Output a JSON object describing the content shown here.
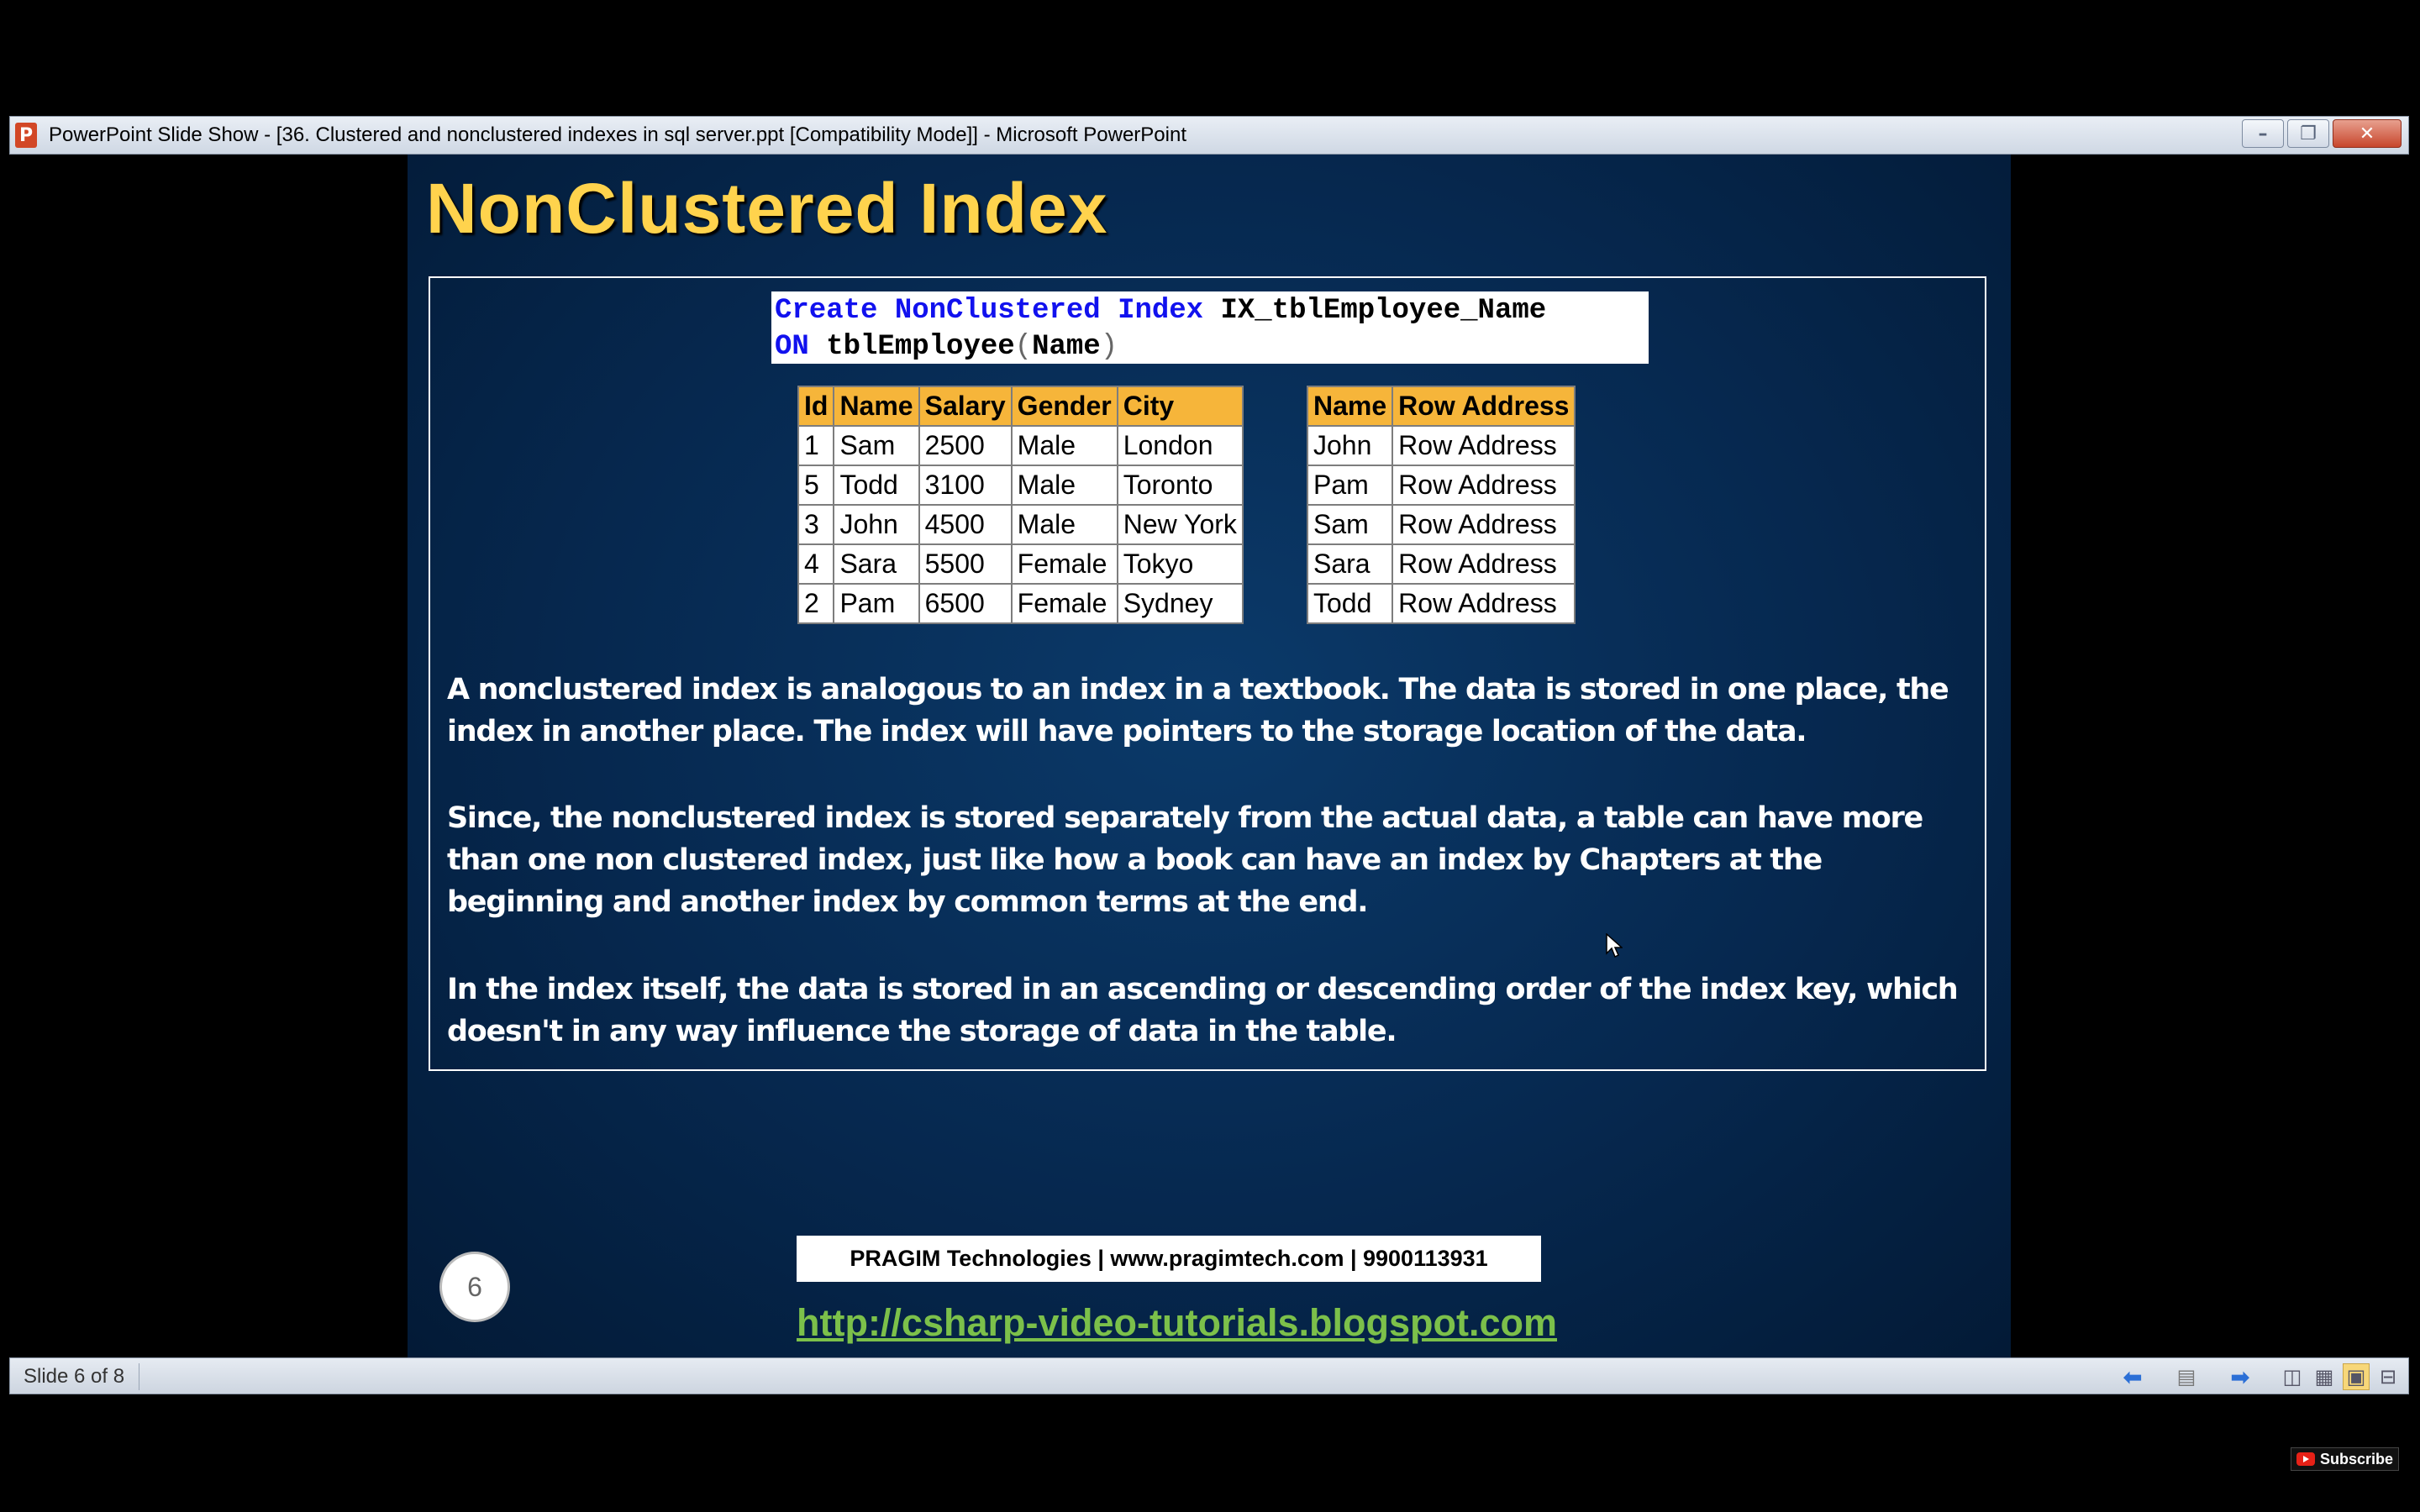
{
  "window": {
    "app_icon_letter": "P",
    "title": "PowerPoint Slide Show - [36. Clustered and nonclustered indexes in sql server.ppt [Compatibility Mode]] - Microsoft PowerPoint",
    "minimize": "–",
    "restore": "❐",
    "close": "✕"
  },
  "slide": {
    "title": "NonClustered Index",
    "code": {
      "l1_kw": "Create NonClustered Index",
      "l1_name": " IX_tblEmployee_Name",
      "l2_kw": "ON",
      "l2_table": " tblEmployee",
      "l2_open": "(",
      "l2_col": "Name",
      "l2_close": ")"
    },
    "employee_table": {
      "headers": [
        "Id",
        "Name",
        "Salary",
        "Gender",
        "City"
      ],
      "rows": [
        [
          "1",
          "Sam",
          "2500",
          "Male",
          "London"
        ],
        [
          "5",
          "Todd",
          "3100",
          "Male",
          "Toronto"
        ],
        [
          "3",
          "John",
          "4500",
          "Male",
          "New York"
        ],
        [
          "4",
          "Sara",
          "5500",
          "Female",
          "Tokyo"
        ],
        [
          "2",
          "Pam",
          "6500",
          "Female",
          "Sydney"
        ]
      ]
    },
    "index_table": {
      "headers": [
        "Name",
        "Row Address"
      ],
      "rows": [
        [
          "John",
          "Row Address"
        ],
        [
          "Pam",
          "Row Address"
        ],
        [
          "Sam",
          "Row Address"
        ],
        [
          "Sara",
          "Row Address"
        ],
        [
          "Todd",
          "Row Address"
        ]
      ]
    },
    "paragraphs": [
      "A nonclustered index is analogous to an index in a textbook. The data is stored in one place, the index in another place. The index will have pointers to the storage location of the data.",
      "Since, the nonclustered index is stored separately from the actual data, a table can have more than one non clustered index, just like how a book can have an index by Chapters at the beginning and another index by common terms at the end.",
      "In the index itself, the data is stored in an ascending or descending order of the index key, which doesn't in any way influence the storage of data in the table."
    ],
    "slide_number": "6",
    "footer": "PRAGIM Technologies | www.pragimtech.com | 9900113931",
    "link": "http://csharp-video-tutorials.blogspot.com"
  },
  "statusbar": {
    "slide_info": "Slide 6 of 8"
  },
  "overlay": {
    "subscribe": "Subscribe"
  }
}
